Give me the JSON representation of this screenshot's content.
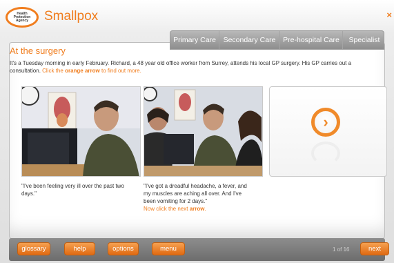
{
  "app": {
    "logo_text": [
      "Health",
      "Protection",
      "Agency"
    ],
    "title": "Smallpox",
    "close_glyph": "×"
  },
  "tabs": [
    "Primary Care",
    "Secondary Care",
    "Pre-hospital Care",
    "Specialist"
  ],
  "scene": {
    "title": "At the surgery",
    "description_plain": "It's a Tuesday morning in early February. Richard, a 48 year old office worker from Surrey, attends his local GP surgery. His GP carries out a consultation.",
    "instruction_pre": "Click the",
    "instruction_bold": "orange arrow",
    "instruction_post": "to find out more."
  },
  "captions": {
    "first": "\"I've been feeling very ill over the past two days.\"",
    "second_quote": "\"I've got a dreadful headache, a fever, and my muscles are aching all over. And I've been vomiting for 2 days.\"",
    "second_next_pre": "Now click the next",
    "second_next_bold": "arrow"
  },
  "arrow": {
    "icon": "chevron-right-icon",
    "glyph": "›"
  },
  "footer": {
    "glossary": "glossary",
    "help": "help",
    "options": "options",
    "menu": "menu",
    "page": "1 of 16",
    "next": "next"
  },
  "colors": {
    "accent": "#f07d1e",
    "tab_bg": "#a0a0a0",
    "bar_bg": "#7a7a7a"
  }
}
